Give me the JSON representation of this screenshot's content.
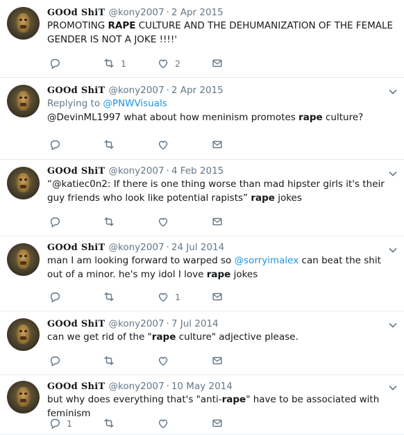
{
  "tweets": [
    {
      "name": "GOOd ShiT",
      "handle": "@kony2007",
      "sep": "·",
      "date": "2 Apr 2015",
      "reply_prefix": "",
      "reply_to": "",
      "segments": [
        {
          "t": "PROMOTING ",
          "b": false
        },
        {
          "t": "RAPE",
          "b": true
        },
        {
          "t": " CULTURE AND THE DEHUMANIZATION OF THE FEMALE GENDER IS NOT A JOKE !!!!'",
          "b": false
        }
      ],
      "counts": {
        "reply": "",
        "retweet": "1",
        "like": "2"
      }
    },
    {
      "name": "GOOd ShiT",
      "handle": "@kony2007",
      "sep": "·",
      "date": "2 Apr 2015",
      "reply_prefix": "Replying to ",
      "reply_to": "@PNWVisuals",
      "segments": [
        {
          "t": "@DevinML1997 what about how meninism promotes ",
          "b": false
        },
        {
          "t": "rape",
          "b": true
        },
        {
          "t": " culture?",
          "b": false
        }
      ],
      "counts": {
        "reply": "",
        "retweet": "",
        "like": ""
      }
    },
    {
      "name": "GOOd ShiT",
      "handle": "@kony2007",
      "sep": "·",
      "date": "4 Feb 2015",
      "reply_prefix": "",
      "reply_to": "",
      "segments": [
        {
          "t": "“@katiec0n2: If there is one thing worse than mad hipster girls it's their guy friends who look like potential rapists” ",
          "b": false
        },
        {
          "t": "rape",
          "b": true
        },
        {
          "t": " jokes",
          "b": false
        }
      ],
      "counts": {
        "reply": "",
        "retweet": "",
        "like": ""
      }
    },
    {
      "name": "GOOd ShiT",
      "handle": "@kony2007",
      "sep": "·",
      "date": "24 Jul 2014",
      "reply_prefix": "",
      "reply_to": "",
      "segments": [
        {
          "t": "man I am looking forward to warped so ",
          "b": false
        },
        {
          "t": "@sorryimalex",
          "b": false,
          "link": true
        },
        {
          "t": " can beat the shit out of a minor. he's my idol I love ",
          "b": false
        },
        {
          "t": "rape",
          "b": true
        },
        {
          "t": " jokes",
          "b": false
        }
      ],
      "counts": {
        "reply": "",
        "retweet": "",
        "like": "1"
      }
    },
    {
      "name": "GOOd ShiT",
      "handle": "@kony2007",
      "sep": "·",
      "date": "7 Jul 2014",
      "reply_prefix": "",
      "reply_to": "",
      "segments": [
        {
          "t": "can we get rid of the \"",
          "b": false
        },
        {
          "t": "rape",
          "b": true
        },
        {
          "t": " culture\"  adjective please.",
          "b": false
        }
      ],
      "counts": {
        "reply": "",
        "retweet": "",
        "like": ""
      }
    },
    {
      "name": "GOOd ShiT",
      "handle": "@kony2007",
      "sep": "·",
      "date": "10 May 2014",
      "reply_prefix": "",
      "reply_to": "",
      "segments": [
        {
          "t": "but why does everything that's \"anti-",
          "b": false
        },
        {
          "t": "rape",
          "b": true
        },
        {
          "t": "\" have to be associated with feminism",
          "b": false
        }
      ],
      "counts": {
        "reply": "1",
        "retweet": "",
        "like": ""
      }
    }
  ],
  "icons": {
    "reply": "reply-icon",
    "retweet": "retweet-icon",
    "like": "heart-icon",
    "dm": "envelope-icon",
    "menu": "chevron-down-icon"
  },
  "colors": {
    "link": "#1b95e0",
    "muted": "#657786",
    "text": "#14171a",
    "divider": "#e6ecf0"
  }
}
